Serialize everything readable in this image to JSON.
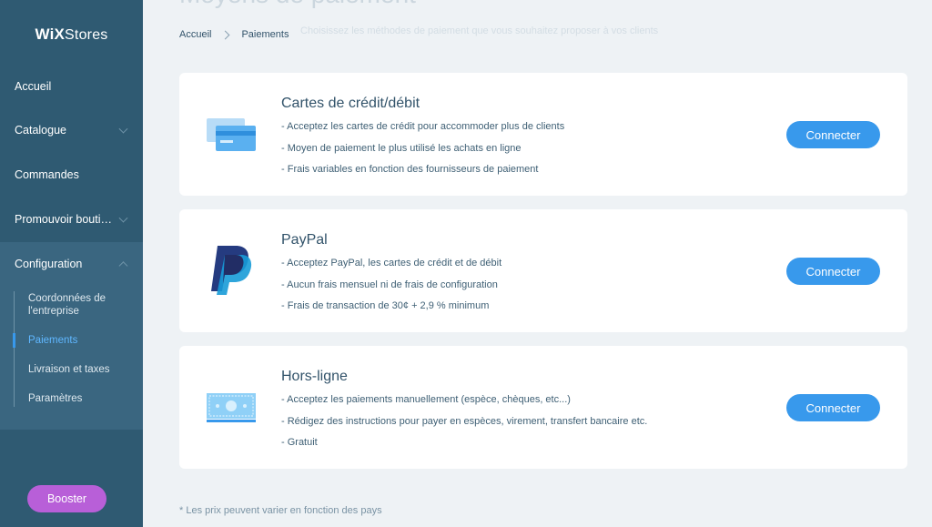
{
  "app": {
    "brand_bold": "WiX",
    "brand_light": "Stores"
  },
  "sidebar": {
    "items": [
      {
        "label": "Accueil"
      },
      {
        "label": "Catalogue"
      },
      {
        "label": "Commandes"
      },
      {
        "label": "Promouvoir bouti…"
      },
      {
        "label": "Configuration"
      }
    ],
    "sub_items": [
      {
        "label": "Coordonnées de l'entreprise"
      },
      {
        "label": "Paiements",
        "active": true
      },
      {
        "label": "Livraison et taxes"
      },
      {
        "label": "Paramètres"
      }
    ],
    "boost_label": "Booster"
  },
  "header": {
    "title": "Moyens de paiement",
    "breadcrumb": [
      "Accueil",
      "Paiements"
    ],
    "subtitle": "Choisissez les méthodes de paiement que vous souhaitez proposer à vos clients"
  },
  "cards": [
    {
      "title": "Cartes de crédit/débit",
      "lines": [
        "- Acceptez les cartes de crédit pour accommoder plus de clients",
        "- Moyen de paiement le plus utilisé les achats en ligne",
        "- Frais variables en fonction des fournisseurs de paiement"
      ],
      "button": "Connecter",
      "icon": "credit-card-icon"
    },
    {
      "title": "PayPal",
      "lines": [
        "- Acceptez PayPal, les cartes de crédit et de débit",
        "- Aucun frais mensuel ni de frais de configuration",
        "- Frais de transaction de 30¢ + 2,9 % minimum"
      ],
      "button": "Connecter",
      "icon": "paypal-icon"
    },
    {
      "title": "Hors-ligne",
      "lines": [
        "- Acceptez les paiements manuellement (espèce, chèques, etc...)",
        "- Rédigez des instructions pour payer en espèces, virement, transfert bancaire etc.",
        "- Gratuit"
      ],
      "button": "Connecter",
      "icon": "banknote-icon"
    }
  ],
  "footnote": "* Les prix peuvent varier en fonction des pays",
  "colors": {
    "sidebar": "#2f5a72",
    "sidebar_active_section": "#3a6680",
    "accent": "#3899ec",
    "boost": "#b85fd8",
    "background": "#eef2f5"
  }
}
